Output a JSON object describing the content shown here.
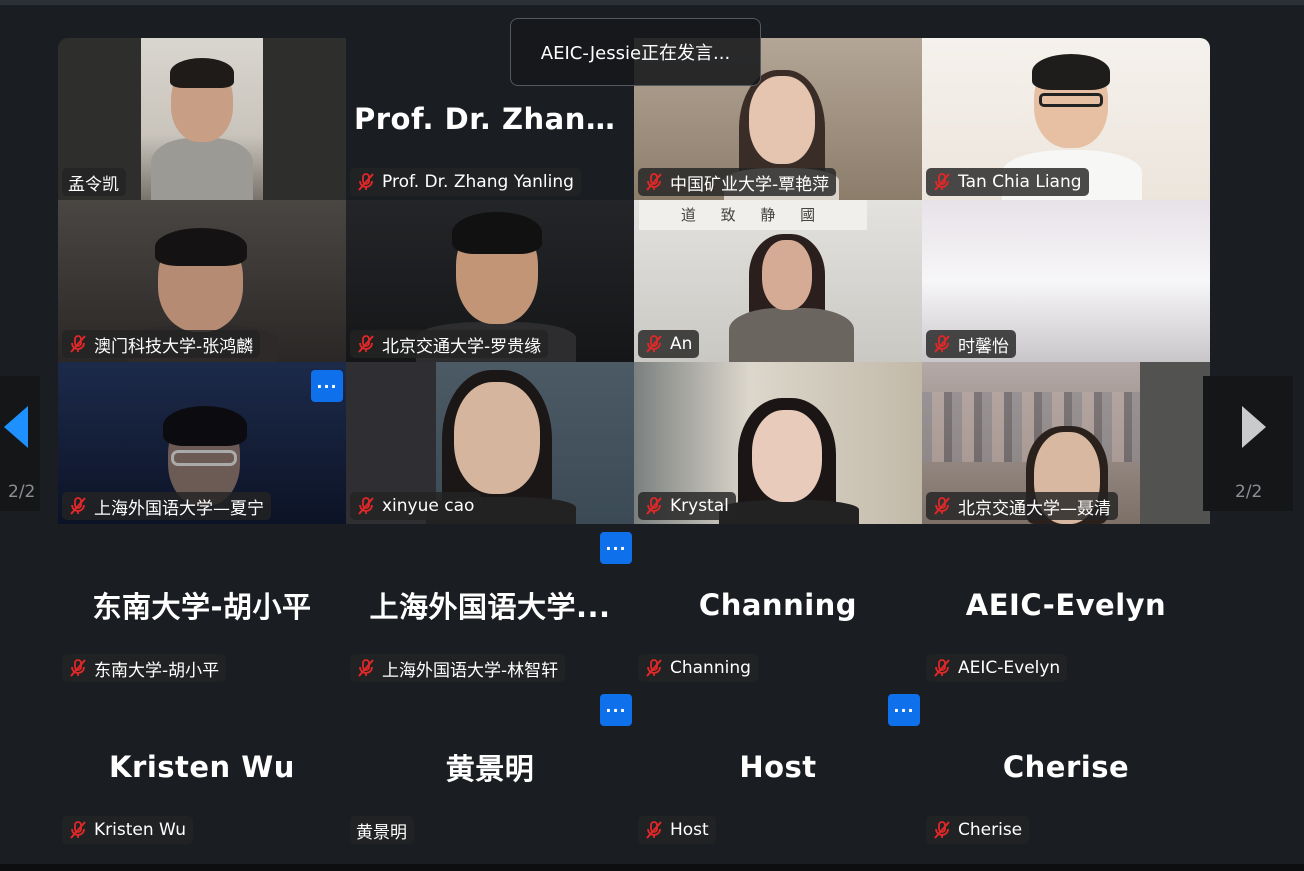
{
  "speaker_banner": "AEIC-Jessie正在发言...",
  "colors": {
    "accent": "#0e71eb",
    "mute": "#e02828",
    "background": "#1a1d21"
  },
  "pagination": {
    "left": "2/2",
    "right": "2/2"
  },
  "more_button_label": "···",
  "participants": [
    {
      "id": "meng",
      "name": "孟令凯",
      "muted": false,
      "video": true
    },
    {
      "id": "zhang",
      "name": "Prof. Dr. Zhang Yanling",
      "big": "Prof. Dr. Zhang...",
      "muted": true,
      "video": false
    },
    {
      "id": "kuang",
      "name": "中国矿业大学-覃艳萍",
      "muted": true,
      "video": true
    },
    {
      "id": "tan",
      "name": "Tan Chia Liang",
      "muted": true,
      "video": true
    },
    {
      "id": "macau",
      "name": "澳门科技大学-张鸿麟",
      "muted": true,
      "video": true
    },
    {
      "id": "bjtu",
      "name": "北京交通大学-罗贵缘",
      "muted": true,
      "video": true
    },
    {
      "id": "an",
      "name": "An",
      "plaque": "道 致 静 國",
      "muted": true,
      "video": true
    },
    {
      "id": "shi",
      "name": "时馨怡",
      "muted": true,
      "video": true
    },
    {
      "id": "xia",
      "name": "上海外国语大学—夏宁",
      "muted": true,
      "video": true
    },
    {
      "id": "cao",
      "name": "xinyue cao",
      "muted": true,
      "video": true
    },
    {
      "id": "krystal",
      "name": "Krystal",
      "muted": true,
      "video": true
    },
    {
      "id": "nie",
      "name": "北京交通大学—聂清",
      "muted": true,
      "video": true
    },
    {
      "id": "hu",
      "name": "东南大学-胡小平",
      "big": "东南大学-胡小平",
      "muted": true,
      "video": false
    },
    {
      "id": "lin",
      "name": "上海外国语大学-林智轩",
      "big": "上海外国语大学...",
      "muted": true,
      "video": false
    },
    {
      "id": "channing",
      "name": "Channing",
      "big": "Channing",
      "muted": true,
      "video": false
    },
    {
      "id": "evelyn",
      "name": "AEIC-Evelyn",
      "big": "AEIC-Evelyn",
      "muted": true,
      "video": false
    },
    {
      "id": "kristen",
      "name": "Kristen Wu",
      "big": "Kristen Wu",
      "muted": true,
      "video": false
    },
    {
      "id": "huang",
      "name": "黄景明",
      "big": "黄景明",
      "muted": false,
      "video": false
    },
    {
      "id": "host",
      "name": "Host",
      "big": "Host",
      "muted": true,
      "video": false
    },
    {
      "id": "cherise",
      "name": "Cherise",
      "big": "Cherise",
      "muted": true,
      "video": false
    }
  ]
}
